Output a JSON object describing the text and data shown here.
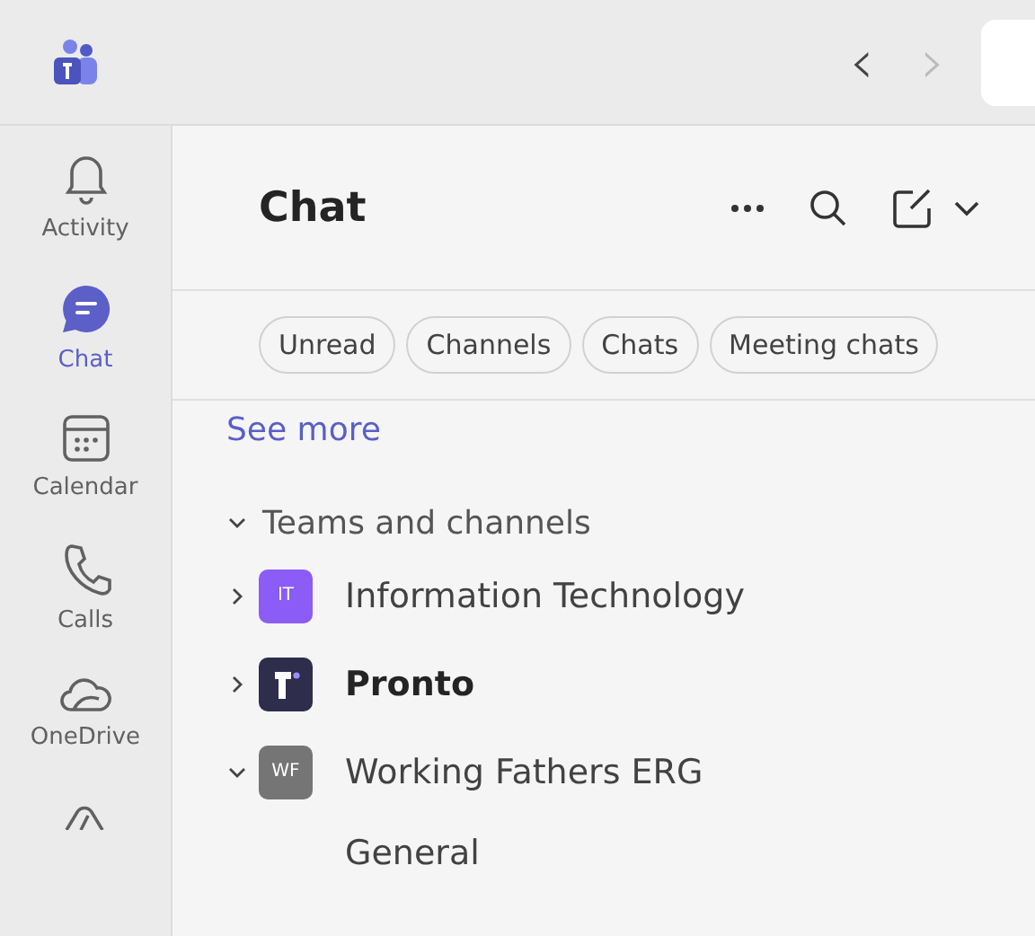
{
  "top_bar": {
    "back": {
      "label": "‹",
      "disabled": false
    },
    "forward": {
      "label": "›",
      "disabled": true
    }
  },
  "rail": [
    {
      "kind": "bell",
      "label": "Activity",
      "selected": false
    },
    {
      "kind": "chat",
      "label": "Chat",
      "selected": true
    },
    {
      "kind": "calendar",
      "label": "Calendar",
      "selected": false
    },
    {
      "kind": "phone",
      "label": "Calls",
      "selected": false
    },
    {
      "kind": "cloud",
      "label": "OneDrive",
      "selected": false
    },
    {
      "kind": "apps",
      "selected": false
    }
  ],
  "header": {
    "title": "Chat"
  },
  "filters": [
    {
      "label": "Unread",
      "selected": false
    },
    {
      "label": "Channels",
      "selected": false
    },
    {
      "label": "Chats",
      "selected": false
    },
    {
      "label": "Meeting chats",
      "selected": false
    }
  ],
  "see_more": "See more",
  "section": {
    "label": "Teams and channels",
    "expanded": true
  },
  "teams": [
    {
      "name": "Information Technology",
      "avatar": "IT",
      "kind": "initials",
      "color": "#8b5cf6",
      "expanded": false,
      "unread": false
    },
    {
      "name": "Pronto",
      "kind": "logo",
      "color": "#2f2d4c",
      "expanded": false,
      "unread": true
    },
    {
      "name": "Working Fathers ERG",
      "avatar": "WF",
      "kind": "initials",
      "color": "#757575",
      "expanded": true,
      "unread": false,
      "children": [
        {
          "name": "General"
        }
      ]
    }
  ]
}
